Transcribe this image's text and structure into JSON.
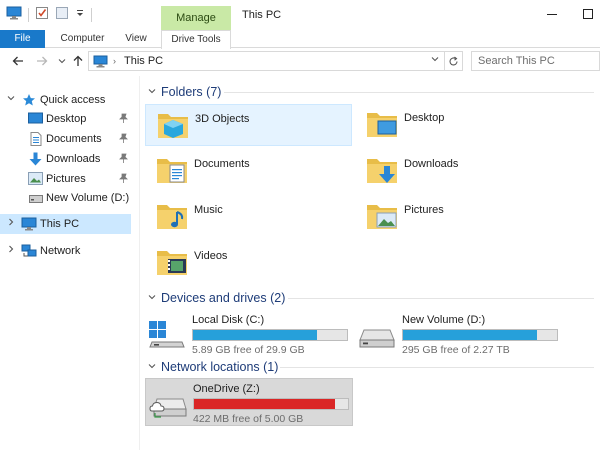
{
  "window": {
    "title": "This PC",
    "contextual_tab": "Manage"
  },
  "ribbon": {
    "tabs": [
      {
        "label": "File"
      },
      {
        "label": "Computer"
      },
      {
        "label": "View"
      },
      {
        "label": "Drive Tools"
      }
    ]
  },
  "address": {
    "crumb": "This PC"
  },
  "search": {
    "placeholder": "Search This PC"
  },
  "sidebar": {
    "quick_access": "Quick access",
    "items": [
      {
        "label": "Desktop",
        "icon": "desktop-icon",
        "pinned": true
      },
      {
        "label": "Documents",
        "icon": "documents-icon",
        "pinned": true
      },
      {
        "label": "Downloads",
        "icon": "downloads-icon",
        "pinned": true
      },
      {
        "label": "Pictures",
        "icon": "pictures-icon",
        "pinned": true
      },
      {
        "label": "New Volume (D:)",
        "icon": "drive-icon",
        "pinned": false
      }
    ],
    "this_pc": "This PC",
    "network": "Network"
  },
  "main": {
    "folders_header": "Folders (7)",
    "folders": [
      {
        "name": "3D Objects",
        "icon": "3d-objects-folder-icon"
      },
      {
        "name": "Desktop",
        "icon": "desktop-folder-icon"
      },
      {
        "name": "Documents",
        "icon": "documents-folder-icon"
      },
      {
        "name": "Downloads",
        "icon": "downloads-folder-icon"
      },
      {
        "name": "Music",
        "icon": "music-folder-icon"
      },
      {
        "name": "Pictures",
        "icon": "pictures-folder-icon"
      },
      {
        "name": "Videos",
        "icon": "videos-folder-icon"
      }
    ],
    "drives_header": "Devices and drives (2)",
    "drives": [
      {
        "name": "Local Disk (C:)",
        "free": "5.89 GB free of 29.9 GB",
        "used_fraction": 0.803,
        "bar_color": "#26a0da"
      },
      {
        "name": "New Volume (D:)",
        "free": "295 GB free of 2.27 TB",
        "used_fraction": 0.873,
        "bar_color": "#26a0da"
      }
    ],
    "network_header": "Network locations (1)",
    "network": [
      {
        "name": "OneDrive (Z:)",
        "free": "422 MB free of 5.00 GB",
        "used_fraction": 0.918,
        "bar_color": "#da2626"
      }
    ]
  },
  "colors": {
    "accent": "#1979ca",
    "selection": "#cce8ff",
    "manage": "#c9e9a6",
    "header_text": "#1e3c78"
  }
}
